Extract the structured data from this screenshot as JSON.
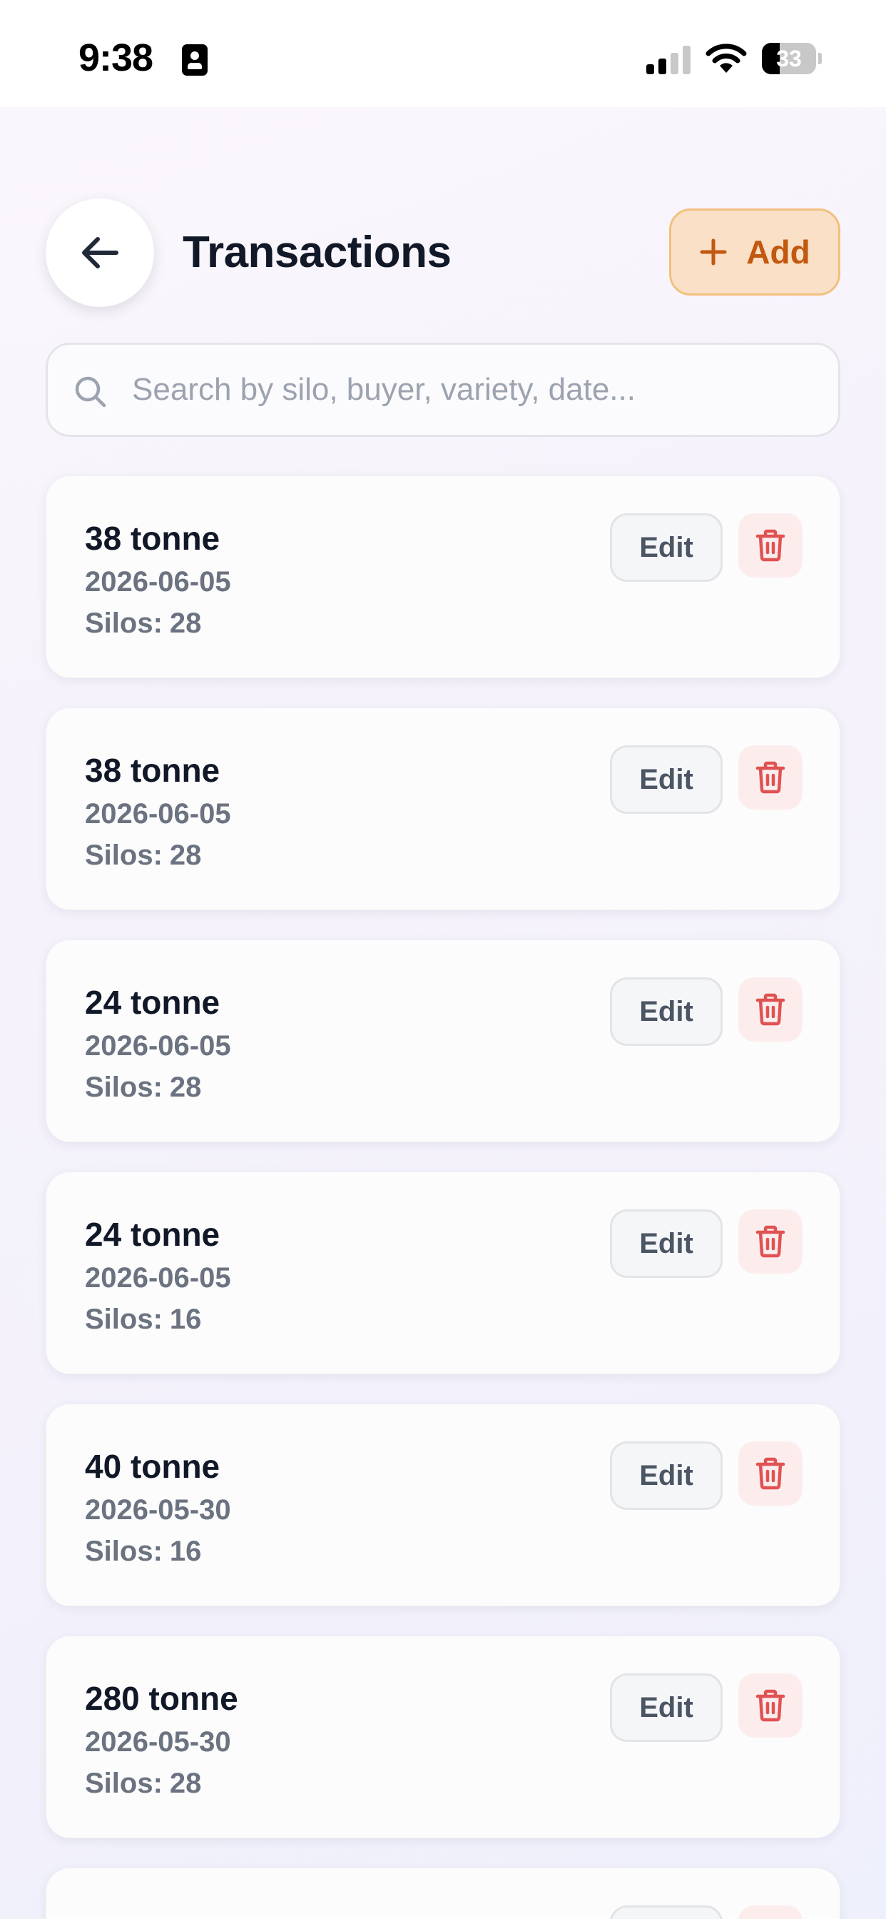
{
  "status_bar": {
    "time": "9:38",
    "battery_level": "33",
    "battery_fraction": 0.33
  },
  "header": {
    "title": "Transactions",
    "add_label": "Add",
    "back_icon": "arrow-left-icon",
    "add_icon": "plus-icon"
  },
  "search": {
    "placeholder": "Search by silo, buyer, variety, date...",
    "value": ""
  },
  "colors": {
    "accent": "#c2580f",
    "accent_bg": "#f9e0c7",
    "delete": "#e05252",
    "delete_bg": "#fdecec"
  },
  "transactions": [
    {
      "amount": "38 tonne",
      "date": "2026-06-05",
      "silos_label": "Silos:",
      "silos": "28",
      "edit_label": "Edit"
    },
    {
      "amount": "38 tonne",
      "date": "2026-06-05",
      "silos_label": "Silos:",
      "silos": "28",
      "edit_label": "Edit"
    },
    {
      "amount": "24 tonne",
      "date": "2026-06-05",
      "silos_label": "Silos:",
      "silos": "28",
      "edit_label": "Edit"
    },
    {
      "amount": "24 tonne",
      "date": "2026-06-05",
      "silos_label": "Silos:",
      "silos": "16",
      "edit_label": "Edit"
    },
    {
      "amount": "40 tonne",
      "date": "2026-05-30",
      "silos_label": "Silos:",
      "silos": "16",
      "edit_label": "Edit"
    },
    {
      "amount": "280 tonne",
      "date": "2026-05-30",
      "silos_label": "Silos:",
      "silos": "28",
      "edit_label": "Edit"
    }
  ]
}
